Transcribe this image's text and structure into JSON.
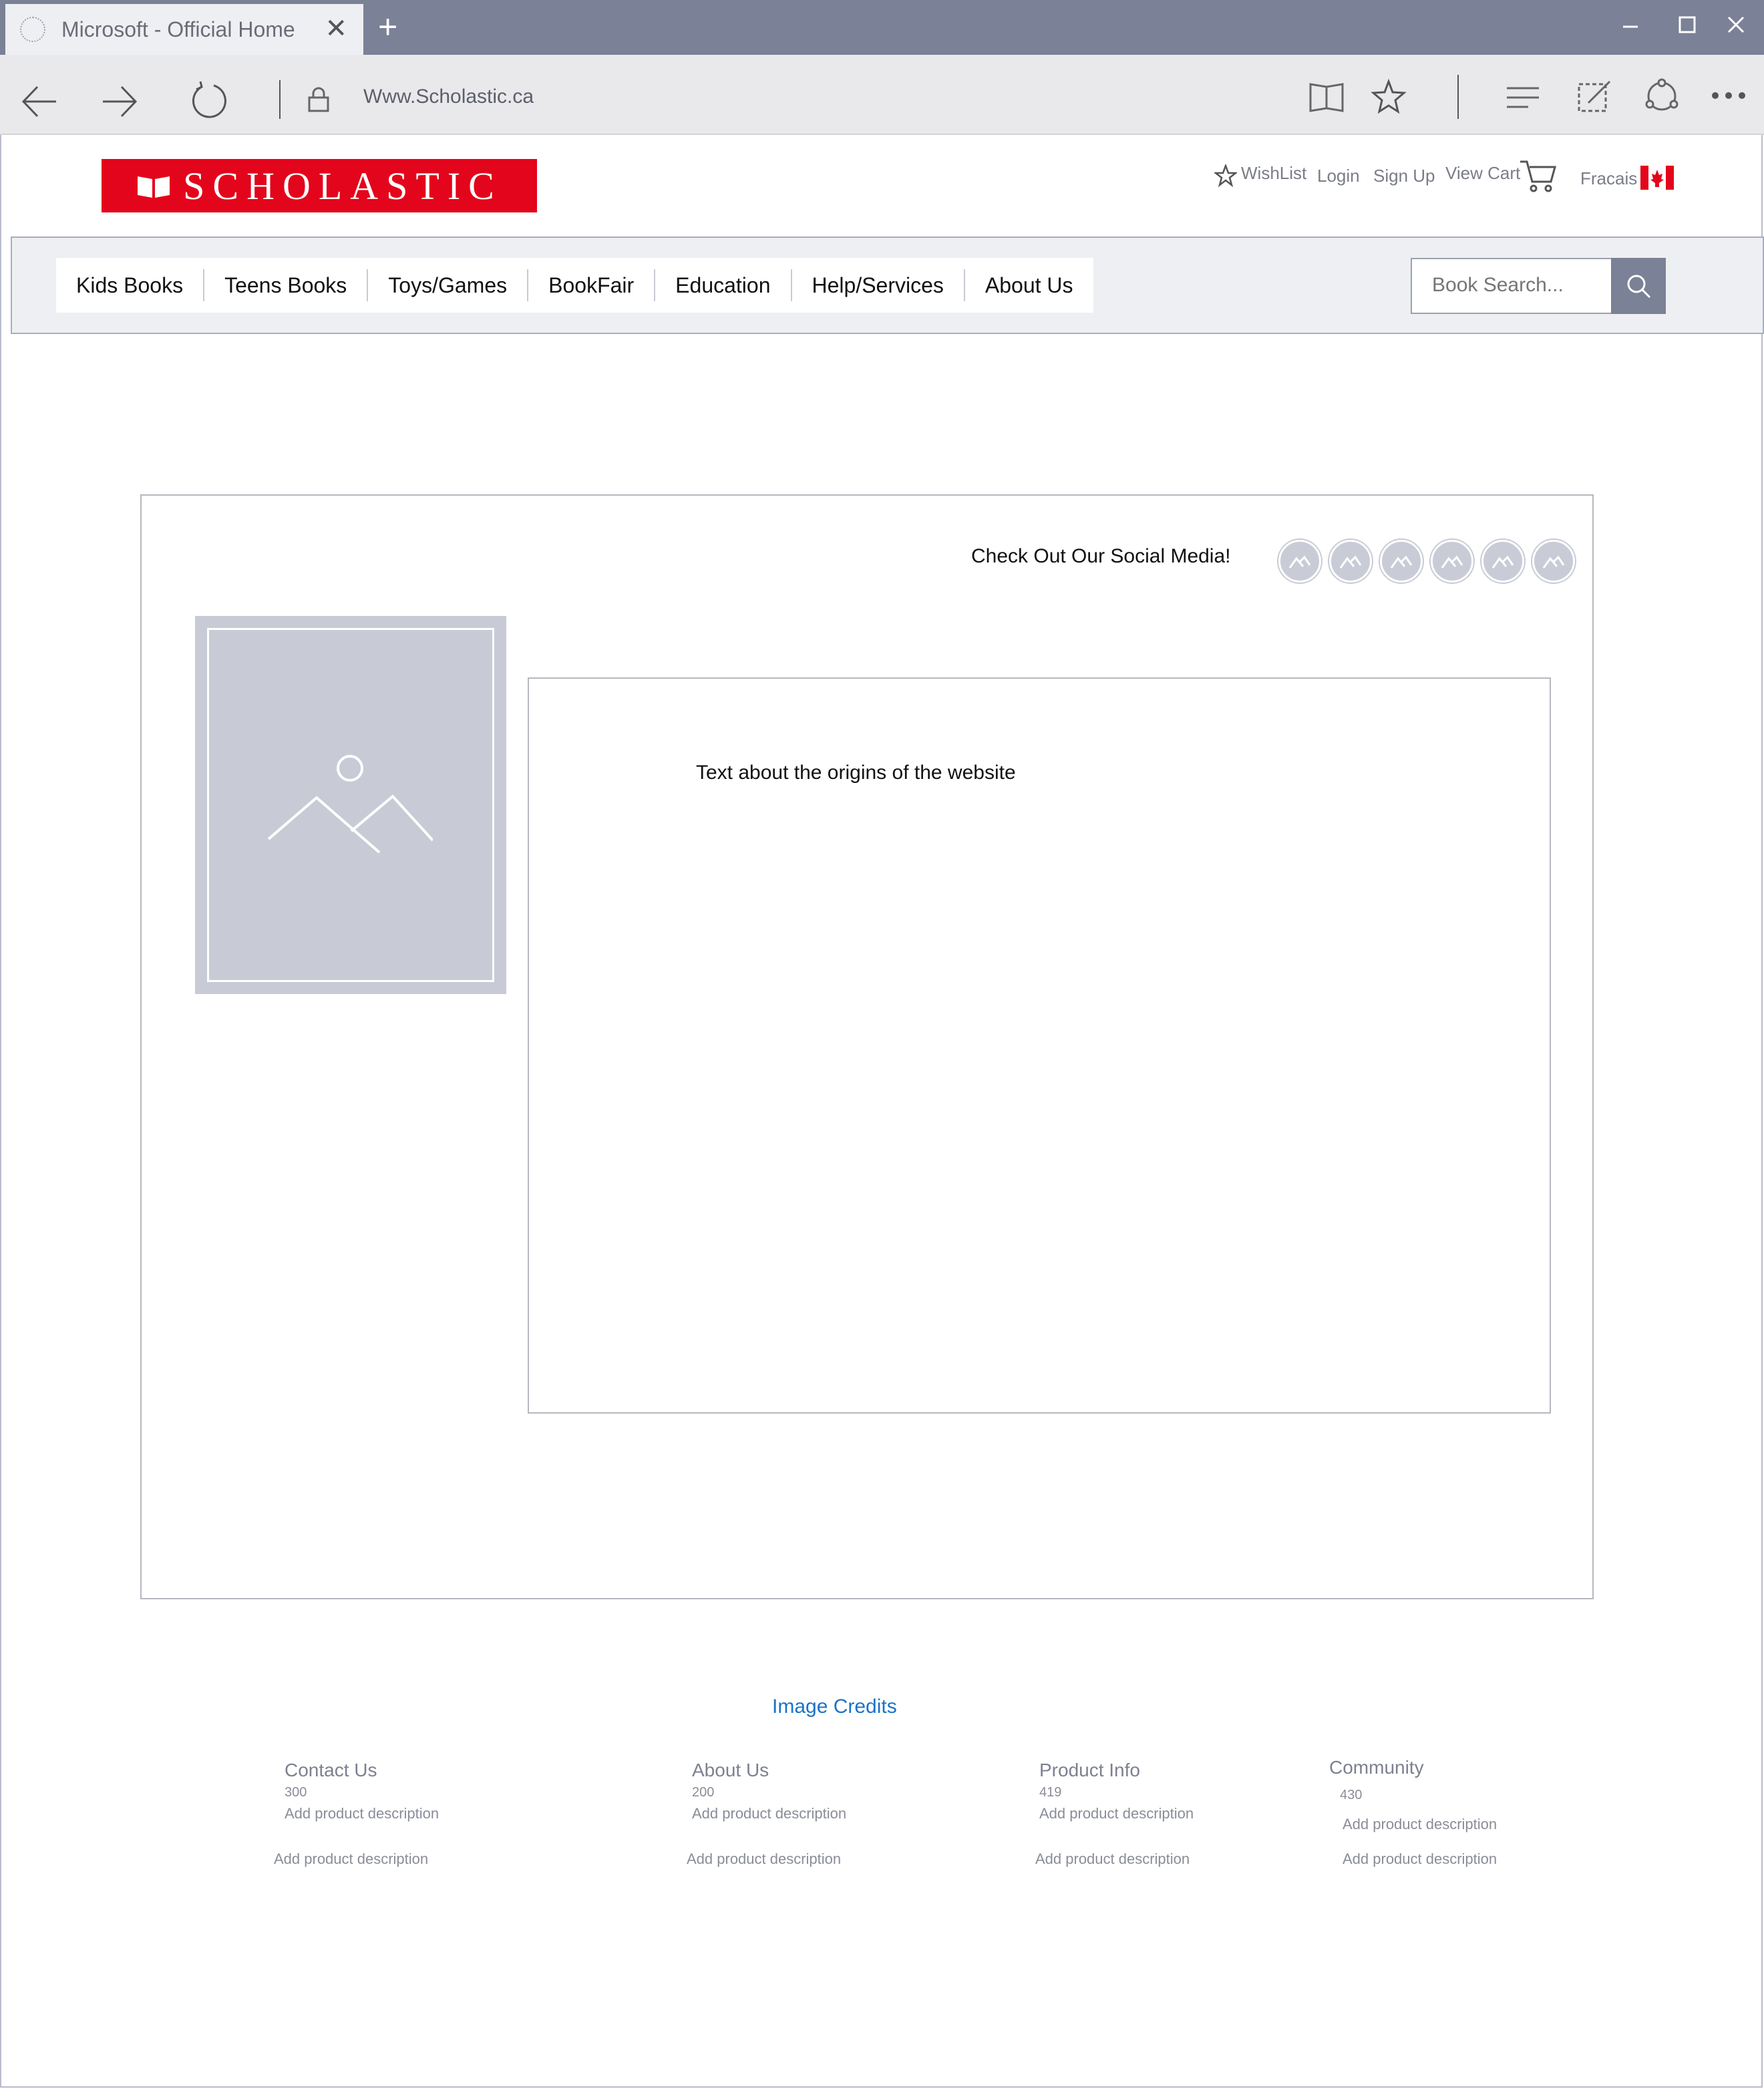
{
  "browser": {
    "tab_title": "Microsoft  - Official Home",
    "new_tab": "+",
    "url": "Www.Scholastic.ca"
  },
  "header": {
    "logo_text": "SCHOLASTIC",
    "wishlist": "WishList",
    "login": "Login",
    "signup": "Sign Up",
    "view_cart": "View Cart",
    "language": "Fracais"
  },
  "nav": {
    "items": [
      "Kids Books",
      "Teens Books",
      "Toys/Games",
      "BookFair",
      "Education",
      "Help/Services",
      "About Us"
    ],
    "search_placeholder": "Book Search..."
  },
  "content": {
    "social_label": "Check Out Our Social Media!",
    "social_icon_count": 6,
    "origins_text": "Text about the origins of the website",
    "image_credits": "Image Credits"
  },
  "footer": {
    "columns": [
      {
        "heading": "Contact Us",
        "number": "300",
        "desc1": "Add product description",
        "desc2": "Add product description"
      },
      {
        "heading": "About Us",
        "number": "200",
        "desc1": "Add product description",
        "desc2": "Add product description"
      },
      {
        "heading": "Product Info",
        "number": "419",
        "desc1": "Add product description",
        "desc2": "Add product description"
      },
      {
        "heading": "Community",
        "number": "430",
        "desc1": "Add product description",
        "desc2": "Add product description"
      }
    ]
  },
  "colors": {
    "brand_red": "#e3051b",
    "chrome": "#7b8196",
    "link_blue": "#1a73c8",
    "placeholder_gray": "#c8cbd6"
  }
}
